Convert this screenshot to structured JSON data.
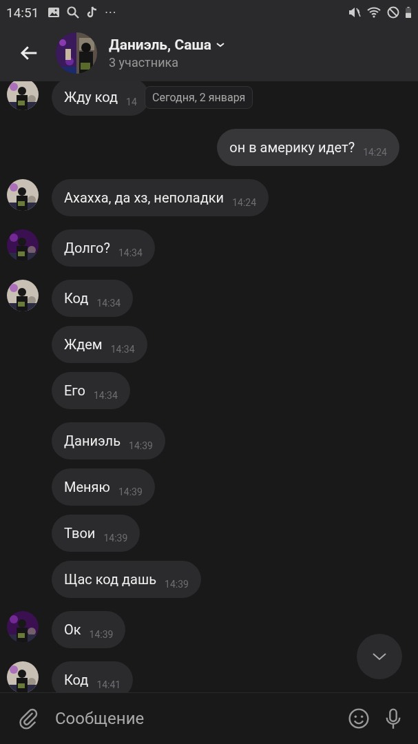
{
  "status_bar": {
    "time": "14:51",
    "more": "···"
  },
  "header": {
    "title": "Даниэль, Саша",
    "subtitle": "3 участника"
  },
  "date_pill": "Сегодня, 2 января",
  "messages": [
    {
      "kind": "incoming",
      "text": "Жду код",
      "time": "14"
    },
    {
      "kind": "outgoing",
      "text": "он в америку идет?",
      "time": "14:24"
    },
    {
      "kind": "incoming",
      "text": "Ахахха, да хз, неполадки",
      "time": "14:24"
    },
    {
      "kind": "incoming",
      "text": "Долго?",
      "time": "14:34"
    },
    {
      "kind": "incoming",
      "text": "Код",
      "time": "14:34"
    },
    {
      "kind": "incoming",
      "text": "Ждем",
      "time": "14:34"
    },
    {
      "kind": "incoming",
      "text": "Его",
      "time": "14:34"
    },
    {
      "kind": "incoming",
      "text": "Даниэль",
      "time": "14:39"
    },
    {
      "kind": "incoming",
      "text": "Меняю",
      "time": "14:39"
    },
    {
      "kind": "incoming",
      "text": "Твои",
      "time": "14:39"
    },
    {
      "kind": "incoming",
      "text": "Щас код дашь",
      "time": "14:39"
    },
    {
      "kind": "incoming",
      "text": "Ок",
      "time": "14:39"
    },
    {
      "kind": "incoming",
      "text": "Код",
      "time": "14:41"
    }
  ],
  "composer": {
    "placeholder": "Сообщение"
  }
}
